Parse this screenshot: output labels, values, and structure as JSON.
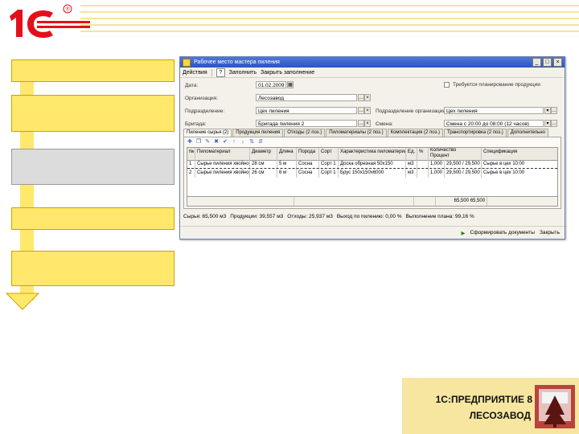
{
  "logo": {
    "text": "1С",
    "trademark": "®",
    "color": "#e3101b"
  },
  "brand": {
    "line1": "1С:ПРЕДПРИЯТИЕ 8",
    "line2": "ЛЕСОЗАВОД",
    "icon": "forest-factory-icon"
  },
  "window": {
    "title": "Рабочее место мастера пиления",
    "toolbar": {
      "actions": "Действия",
      "help": "?",
      "btn2": "Заполнить",
      "btn3": "Закрыть заполнение"
    },
    "form": {
      "date_label": "Дата:",
      "date_value": "01.02.2009",
      "checkbox_label": "Требуется планирование продукции",
      "org_label": "Организация:",
      "org_value": "Лесозавод",
      "division_label": "Подразделение:",
      "division_value": "Цех пиления",
      "division_org_label": "Подразделение организации:",
      "division_org_value": "Цех пиления",
      "brigade_label": "Бригада:",
      "brigade_value": "Бригада пиления 2",
      "shift_label": "Смена:",
      "shift_value": "Смена с 20:00 до 08:00 (12 часов)"
    },
    "tabs": [
      "Пиление сырья (2)",
      "Продукция пиления",
      "Отходы (2 поз.)",
      "Пиломатериалы (2 поз.)",
      "Комплектация (2 поз.)",
      "Транспортировка (2 поз.)",
      "Дополнительно"
    ],
    "grid": {
      "headers": [
        "№",
        "Пиломатериал",
        "Диаметр",
        "Длина",
        "Порода",
        "Сорт",
        "Характеристика пиломатериала",
        "Ед.",
        "%",
        "Количество",
        "Спецификация"
      ],
      "sub_header": "Процент",
      "rows": [
        [
          "1",
          "Сырье пиления хвойное",
          "28 см",
          "5 м",
          "Сосна",
          "Сорт 1",
          "Доска обрезная 50х150",
          "м3",
          "",
          "1,000",
          "29,500 / 29,500 шт",
          "Сырье в цех 10:00"
        ],
        [
          "2",
          "Сырье пиления хвойное",
          "26 см",
          "6 м",
          "Сосна",
          "Сорт 1",
          "Брус 150х150х6000",
          "м3",
          "",
          "1,000",
          "29,500 / 29,500 шт",
          "Сырье в цех 10:00"
        ]
      ],
      "footer_total": "65,500",
      "footer_total2": "65,500"
    },
    "status": {
      "sawn": "Сырья: 65,500 м3",
      "product": "Продукции: 39,557 м3",
      "waste": "Отходы: 25,937 м3",
      "yield": "Выход по пилению: 0,00 %",
      "plan": "Выполнение плана: 99,16 %"
    },
    "bottom": {
      "form_docs": "Сформировать документы",
      "close": "Закрыть"
    }
  },
  "flow": {
    "blocks": [
      "block-1",
      "block-2",
      "block-3",
      "block-4",
      "block-5",
      "block-6"
    ],
    "highlight_index": 2
  }
}
